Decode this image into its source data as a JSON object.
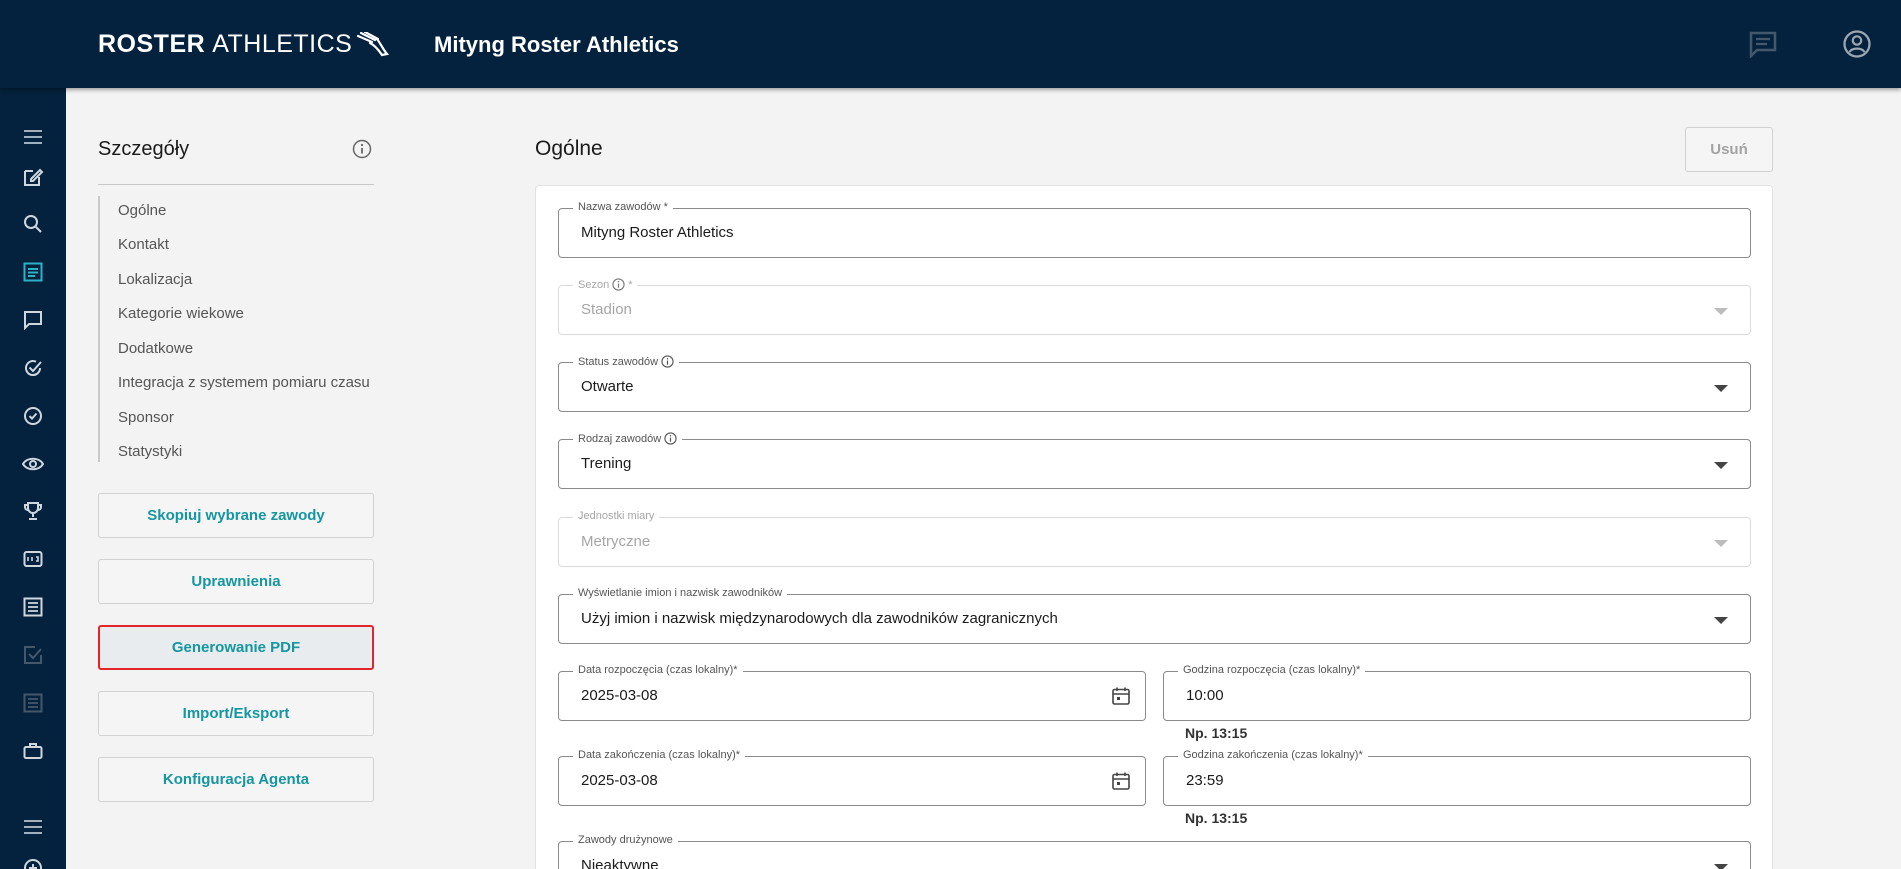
{
  "header": {
    "logo_bold": "ROSTER",
    "logo_light": "ATHLETICS",
    "title": "Mityng Roster Athletics",
    "icons": [
      "chat-icon",
      "account-circle-icon"
    ]
  },
  "rail": {
    "icons": [
      "menu-icon",
      "edit-icon",
      "search-icon",
      "list-icon",
      "message-icon",
      "check-circle-icon",
      "check-badge-icon",
      "eye-icon",
      "trophy-icon",
      "scoreboard-icon",
      "document-list-icon",
      "check-square-icon",
      "document-icon",
      "briefcase-icon",
      "menu-bottom-icon",
      "add-circle-icon"
    ]
  },
  "details": {
    "title": "Szczegóły",
    "nav": [
      "Ogólne",
      "Kontakt",
      "Lokalizacja",
      "Kategorie wiekowe",
      "Dodatkowe",
      "Integracja z systemem pomiaru czasu",
      "Sponsor",
      "Statystyki"
    ],
    "buttons": [
      "Skopiuj wybrane zawody",
      "Uprawnienia",
      "Generowanie PDF",
      "Import/Eksport",
      "Konfiguracja Agenta"
    ]
  },
  "main": {
    "title": "Ogólne",
    "delete_label": "Usuń",
    "fields": {
      "name": {
        "label": "Nazwa zawodów *",
        "value": "Mityng Roster Athletics"
      },
      "season": {
        "label": "Sezon",
        "suffix": "*",
        "value": "Stadion"
      },
      "status": {
        "label": "Status zawodów",
        "value": "Otwarte"
      },
      "type": {
        "label": "Rodzaj zawodów",
        "value": "Trening"
      },
      "units": {
        "label": "Jednostki miary",
        "value": "Metryczne"
      },
      "names_display": {
        "label": "Wyświetlanie imion i nazwisk zawodników",
        "value": "Użyj imion i nazwisk międzynarodowych dla zawodników zagranicznych"
      },
      "start_date": {
        "label": "Data rozpoczęcia (czas lokalny)*",
        "value": "2025-03-08"
      },
      "start_time": {
        "label": "Godzina rozpoczęcia (czas lokalny)*",
        "value": "10:00",
        "hint": "Np. 13:15"
      },
      "end_date": {
        "label": "Data zakończenia (czas lokalny)*",
        "value": "2025-03-08"
      },
      "end_time": {
        "label": "Godzina zakończenia (czas lokalny)*",
        "value": "23:59",
        "hint": "Np. 13:15"
      },
      "team": {
        "label": "Zawody drużynowe",
        "value": "Nieaktywne"
      }
    }
  },
  "colors": {
    "header_bg": "#04223d",
    "accent": "#1596a0",
    "active_outline": "#e0262a"
  }
}
